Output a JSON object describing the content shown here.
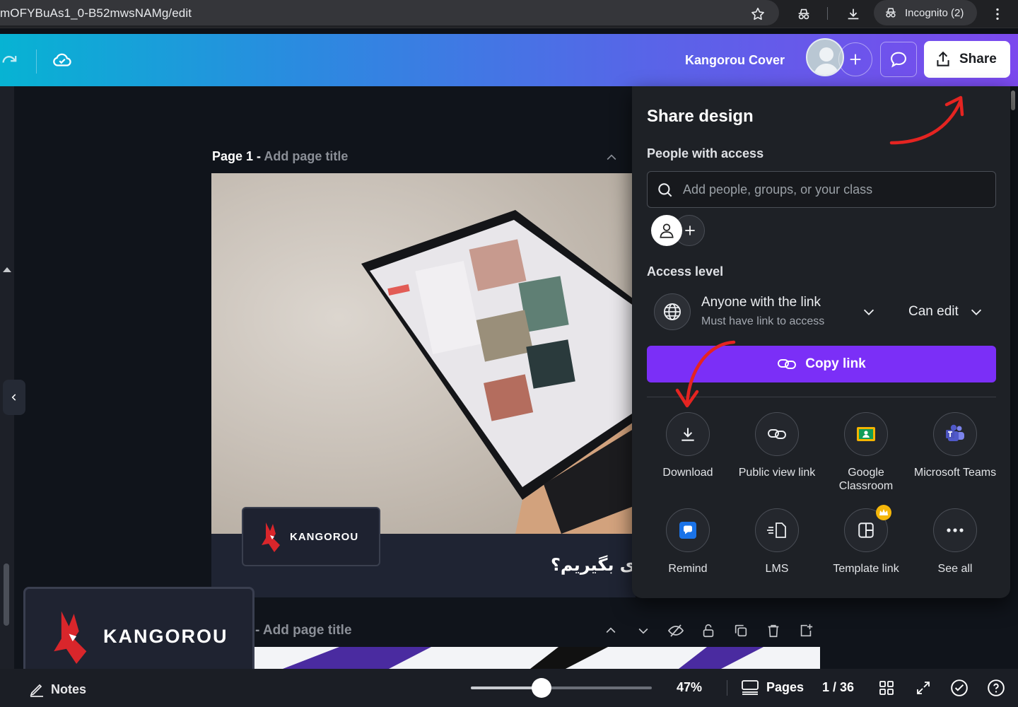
{
  "browser": {
    "url": "mOFYBuAs1_0-B52mwsNAMg/edit",
    "incognito_label": "Incognito (2)",
    "icons": [
      "star-icon",
      "incognito-icon",
      "download-icon",
      "more-vertical-icon"
    ]
  },
  "header": {
    "doc_title": "Kangorou Cover",
    "share_label": "Share",
    "icons": [
      "redo-icon",
      "cloud-saved-icon",
      "add-collaborator-icon",
      "comment-icon",
      "share-upload-icon"
    ]
  },
  "canvas": {
    "page1": {
      "label": "Page 1",
      "separator": " - ",
      "placeholder": "Add page title"
    },
    "page2": {
      "placeholder": "- Add page title"
    },
    "slide_text": "ی بگیریم؟",
    "brand_name": "KANGOROU"
  },
  "bottom_bar": {
    "notes_label": "Notes",
    "zoom_value": 47,
    "zoom_label": "47%",
    "pages_label": "Pages",
    "page_count": "1 / 36"
  },
  "share_panel": {
    "title": "Share design",
    "people_heading": "People with access",
    "search_placeholder": "Add people, groups, or your class",
    "access_heading": "Access level",
    "link_title": "Anyone with the link",
    "link_subtitle": "Must have link to access",
    "permission": "Can edit",
    "copy_label": "Copy link",
    "options": [
      {
        "label": "Download",
        "icon": "download-icon"
      },
      {
        "label": "Public view link",
        "icon": "link-icon"
      },
      {
        "label": "Google Classroom",
        "icon": "google-classroom-icon"
      },
      {
        "label": "Microsoft Teams",
        "icon": "microsoft-teams-icon"
      },
      {
        "label": "Remind",
        "icon": "remind-icon"
      },
      {
        "label": "LMS",
        "icon": "lms-icon"
      },
      {
        "label": "Template link",
        "icon": "template-link-icon"
      },
      {
        "label": "See all",
        "icon": "more-horizontal-icon"
      }
    ]
  },
  "colors": {
    "accent_purple": "#7b2ff7",
    "header_start": "#07b3d3",
    "header_end": "#7b49ee",
    "annotation_red": "#e52421",
    "panel_bg": "#1e2126"
  }
}
